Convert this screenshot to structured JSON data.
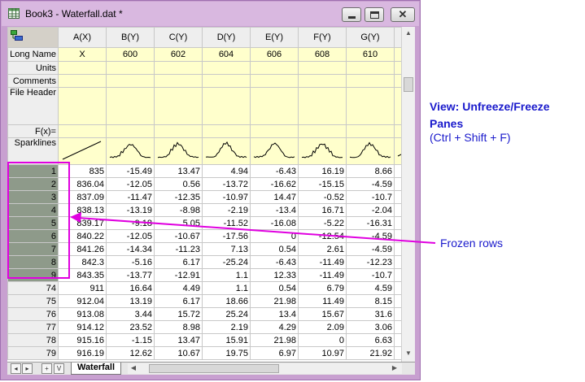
{
  "window": {
    "title": "Book3 - Waterfall.dat *",
    "controls": [
      "minimize-icon",
      "maximize-icon",
      "close-icon"
    ],
    "close_glyph": "✕"
  },
  "columns": [
    "A(X)",
    "B(Y)",
    "C(Y)",
    "D(Y)",
    "E(Y)",
    "F(Y)",
    "G(Y)"
  ],
  "header_rows": {
    "long_name": {
      "label": "Long Name",
      "values": [
        "X",
        "600",
        "602",
        "604",
        "606",
        "608",
        "610"
      ]
    },
    "units": {
      "label": "Units"
    },
    "comments": {
      "label": "Comments"
    },
    "file_header": {
      "label": "File Header"
    },
    "fx": {
      "label": "F(x)="
    },
    "sparklines": {
      "label": "Sparklines"
    }
  },
  "rows": [
    {
      "n": "1",
      "v": [
        "835",
        "-15.49",
        "13.47",
        "4.94",
        "-6.43",
        "16.19",
        "8.66"
      ]
    },
    {
      "n": "2",
      "v": [
        "836.04",
        "-12.05",
        "0.56",
        "-13.72",
        "-16.62",
        "-15.15",
        "-4.59"
      ]
    },
    {
      "n": "3",
      "v": [
        "837.09",
        "-11.47",
        "-12.35",
        "-10.97",
        "14.47",
        "-0.52",
        "-10.7"
      ]
    },
    {
      "n": "4",
      "v": [
        "838.13",
        "-13.19",
        "-8.98",
        "-2.19",
        "-13.4",
        "16.71",
        "-2.04"
      ]
    },
    {
      "n": "5",
      "v": [
        "839.17",
        "-9.18",
        "5.05",
        "-11.52",
        "-16.08",
        "-5.22",
        "-16.31"
      ]
    },
    {
      "n": "6",
      "v": [
        "840.22",
        "-12.05",
        "-10.67",
        "-17.56",
        "0",
        "-12.54",
        "-4.59"
      ]
    },
    {
      "n": "7",
      "v": [
        "841.26",
        "-14.34",
        "-11.23",
        "7.13",
        "0.54",
        "2.61",
        "-4.59"
      ]
    },
    {
      "n": "8",
      "v": [
        "842.3",
        "-5.16",
        "6.17",
        "-25.24",
        "-6.43",
        "-11.49",
        "-12.23"
      ]
    },
    {
      "n": "9",
      "v": [
        "843.35",
        "-13.77",
        "-12.91",
        "1.1",
        "12.33",
        "-11.49",
        "-10.7"
      ]
    },
    {
      "n": "74",
      "v": [
        "911",
        "16.64",
        "4.49",
        "1.1",
        "0.54",
        "6.79",
        "4.59"
      ]
    },
    {
      "n": "75",
      "v": [
        "912.04",
        "13.19",
        "6.17",
        "18.66",
        "21.98",
        "11.49",
        "8.15"
      ]
    },
    {
      "n": "76",
      "v": [
        "913.08",
        "3.44",
        "15.72",
        "25.24",
        "13.4",
        "15.67",
        "31.6"
      ]
    },
    {
      "n": "77",
      "v": [
        "914.12",
        "23.52",
        "8.98",
        "2.19",
        "4.29",
        "2.09",
        "3.06"
      ]
    },
    {
      "n": "78",
      "v": [
        "915.16",
        "-1.15",
        "13.47",
        "15.91",
        "21.98",
        "0",
        "6.63"
      ]
    },
    {
      "n": "79",
      "v": [
        "916.19",
        "12.62",
        "10.67",
        "19.75",
        "6.97",
        "10.97",
        "21.92"
      ]
    }
  ],
  "sheet_tab": "Waterfall",
  "nav_buttons": [
    "◂",
    "▸",
    "+",
    "V"
  ],
  "annotations": {
    "view_command": "View: Unfreeze/Freeze Panes",
    "shortcut": "(Ctrl + Shift + F)",
    "frozen_rows": "Frozen rows"
  },
  "colors": {
    "annotation": "#1a1acc",
    "highlight": "#e000e0",
    "frozen_fill": "#8e9a8a",
    "meta_fill": "#ffffcc"
  }
}
